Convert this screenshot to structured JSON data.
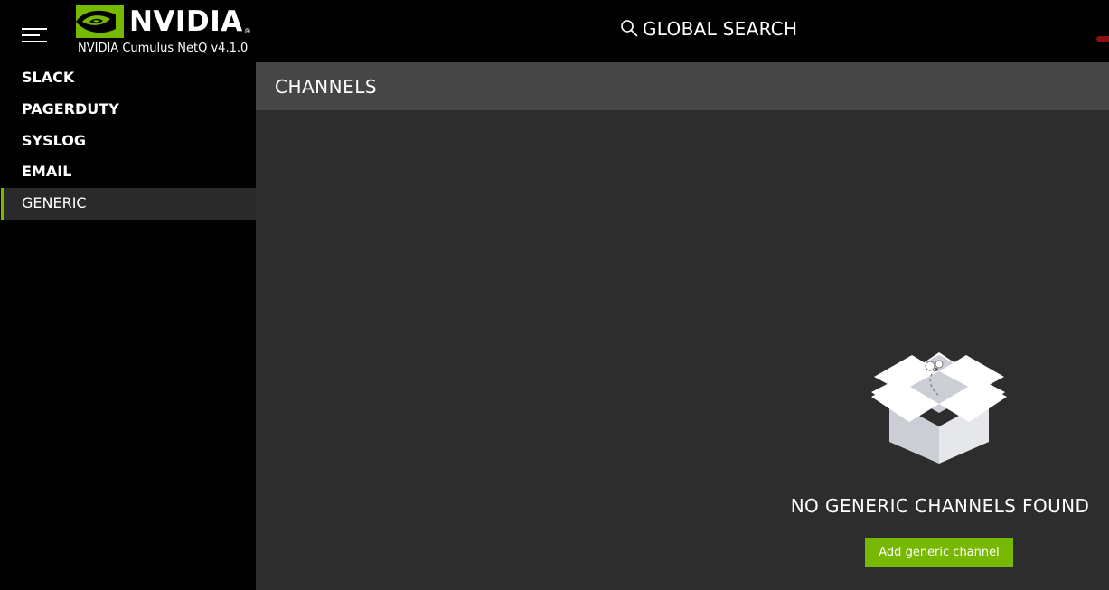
{
  "app": {
    "brand": "NVIDIA",
    "product": "NVIDIA Cumulus NetQ v4.1.0"
  },
  "search": {
    "label": "GLOBAL SEARCH"
  },
  "sidebar": {
    "items": [
      {
        "label": "SLACK"
      },
      {
        "label": "PAGERDUTY"
      },
      {
        "label": "SYSLOG"
      },
      {
        "label": "EMAIL"
      },
      {
        "label": "GENERIC",
        "active": true
      }
    ]
  },
  "main": {
    "title": "CHANNELS",
    "empty_message": "NO GENERIC CHANNELS FOUND",
    "add_button": "Add generic channel"
  },
  "colors": {
    "accent": "#76b900",
    "header_bg": "#464646",
    "content_bg": "#2d2d2d",
    "active_item_bg": "#2a2a2a"
  },
  "icons": {
    "menu": "hamburger-menu-icon",
    "search": "search-icon",
    "logo": "nvidia-eye-logo",
    "empty": "empty-box-icon"
  }
}
